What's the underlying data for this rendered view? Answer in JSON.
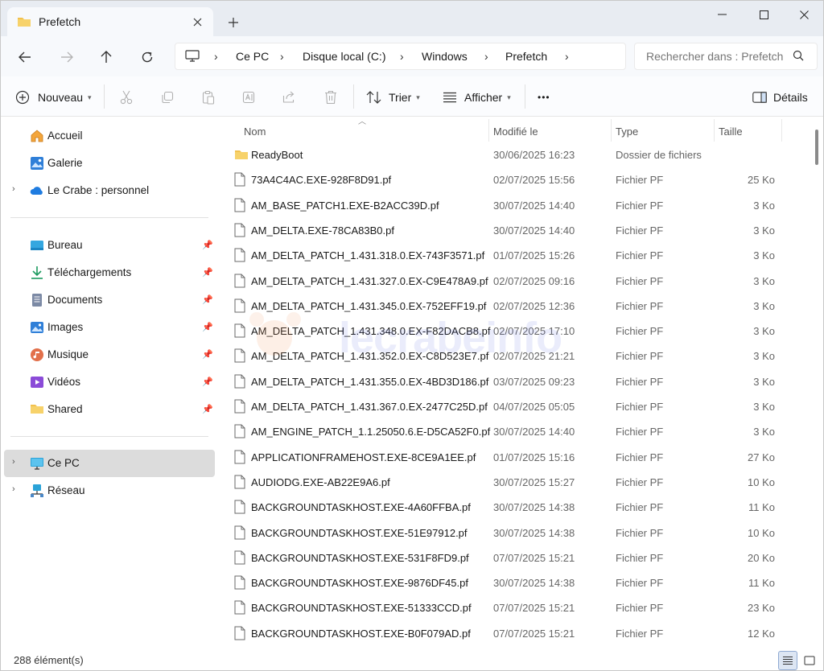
{
  "window": {
    "tab_title": "Prefetch"
  },
  "address": {
    "crumbs": [
      "Ce PC",
      "Disque local (C:)",
      "Windows",
      "Prefetch"
    ],
    "search_placeholder": "Rechercher dans : Prefetch"
  },
  "toolbar": {
    "new_label": "Nouveau",
    "sort_label": "Trier",
    "view_label": "Afficher",
    "more_label": "•••",
    "details_label": "Détails"
  },
  "sidebar": {
    "top": [
      {
        "label": "Accueil",
        "icon": "home-icon"
      },
      {
        "label": "Galerie",
        "icon": "gallery-icon"
      },
      {
        "label": "Le Crabe : personnel",
        "icon": "onedrive-icon"
      }
    ],
    "pinned": [
      {
        "label": "Bureau",
        "icon": "desktop-icon"
      },
      {
        "label": "Téléchargements",
        "icon": "download-icon"
      },
      {
        "label": "Documents",
        "icon": "documents-icon"
      },
      {
        "label": "Images",
        "icon": "images-icon"
      },
      {
        "label": "Musique",
        "icon": "music-icon"
      },
      {
        "label": "Vidéos",
        "icon": "videos-icon"
      },
      {
        "label": "Shared",
        "icon": "folder-icon"
      }
    ],
    "bottom": [
      {
        "label": "Ce PC",
        "icon": "pc-icon"
      },
      {
        "label": "Réseau",
        "icon": "network-icon"
      }
    ]
  },
  "columns": {
    "name": "Nom",
    "modified": "Modifié le",
    "type": "Type",
    "size": "Taille"
  },
  "files": [
    {
      "name": "ReadyBoot",
      "date": "30/06/2025 16:23",
      "type": "Dossier de fichiers",
      "size": "",
      "folder": true
    },
    {
      "name": "73A4C4AC.EXE-928F8D91.pf",
      "date": "02/07/2025 15:56",
      "type": "Fichier PF",
      "size": "25 Ko"
    },
    {
      "name": "AM_BASE_PATCH1.EXE-B2ACC39D.pf",
      "date": "30/07/2025 14:40",
      "type": "Fichier PF",
      "size": "3 Ko"
    },
    {
      "name": "AM_DELTA.EXE-78CA83B0.pf",
      "date": "30/07/2025 14:40",
      "type": "Fichier PF",
      "size": "3 Ko"
    },
    {
      "name": "AM_DELTA_PATCH_1.431.318.0.EX-743F3571.pf",
      "date": "01/07/2025 15:26",
      "type": "Fichier PF",
      "size": "3 Ko"
    },
    {
      "name": "AM_DELTA_PATCH_1.431.327.0.EX-C9E478A9.pf",
      "date": "02/07/2025 09:16",
      "type": "Fichier PF",
      "size": "3 Ko"
    },
    {
      "name": "AM_DELTA_PATCH_1.431.345.0.EX-752EFF19.pf",
      "date": "02/07/2025 12:36",
      "type": "Fichier PF",
      "size": "3 Ko"
    },
    {
      "name": "AM_DELTA_PATCH_1.431.348.0.EX-F82DACB8.pf",
      "date": "02/07/2025 17:10",
      "type": "Fichier PF",
      "size": "3 Ko"
    },
    {
      "name": "AM_DELTA_PATCH_1.431.352.0.EX-C8D523E7.pf",
      "date": "02/07/2025 21:21",
      "type": "Fichier PF",
      "size": "3 Ko"
    },
    {
      "name": "AM_DELTA_PATCH_1.431.355.0.EX-4BD3D186.pf",
      "date": "03/07/2025 09:23",
      "type": "Fichier PF",
      "size": "3 Ko"
    },
    {
      "name": "AM_DELTA_PATCH_1.431.367.0.EX-2477C25D.pf",
      "date": "04/07/2025 05:05",
      "type": "Fichier PF",
      "size": "3 Ko"
    },
    {
      "name": "AM_ENGINE_PATCH_1.1.25050.6.E-D5CA52F0.pf",
      "date": "30/07/2025 14:40",
      "type": "Fichier PF",
      "size": "3 Ko"
    },
    {
      "name": "APPLICATIONFRAMEHOST.EXE-8CE9A1EE.pf",
      "date": "01/07/2025 15:16",
      "type": "Fichier PF",
      "size": "27 Ko"
    },
    {
      "name": "AUDIODG.EXE-AB22E9A6.pf",
      "date": "30/07/2025 15:27",
      "type": "Fichier PF",
      "size": "10 Ko"
    },
    {
      "name": "BACKGROUNDTASKHOST.EXE-4A60FFBA.pf",
      "date": "30/07/2025 14:38",
      "type": "Fichier PF",
      "size": "11 Ko"
    },
    {
      "name": "BACKGROUNDTASKHOST.EXE-51E97912.pf",
      "date": "30/07/2025 14:38",
      "type": "Fichier PF",
      "size": "10 Ko"
    },
    {
      "name": "BACKGROUNDTASKHOST.EXE-531F8FD9.pf",
      "date": "07/07/2025 15:21",
      "type": "Fichier PF",
      "size": "20 Ko"
    },
    {
      "name": "BACKGROUNDTASKHOST.EXE-9876DF45.pf",
      "date": "30/07/2025 14:38",
      "type": "Fichier PF",
      "size": "11 Ko"
    },
    {
      "name": "BACKGROUNDTASKHOST.EXE-51333CCD.pf",
      "date": "07/07/2025 15:21",
      "type": "Fichier PF",
      "size": "23 Ko"
    },
    {
      "name": "BACKGROUNDTASKHOST.EXE-B0F079AD.pf",
      "date": "07/07/2025 15:21",
      "type": "Fichier PF",
      "size": "12 Ko"
    }
  ],
  "status": {
    "count": "288 élément(s)"
  },
  "watermark": "lecrabeinfo",
  "colors": {
    "folder": "#f2c14e",
    "accent": "#0067c0",
    "selected": "#dcdcdc"
  }
}
